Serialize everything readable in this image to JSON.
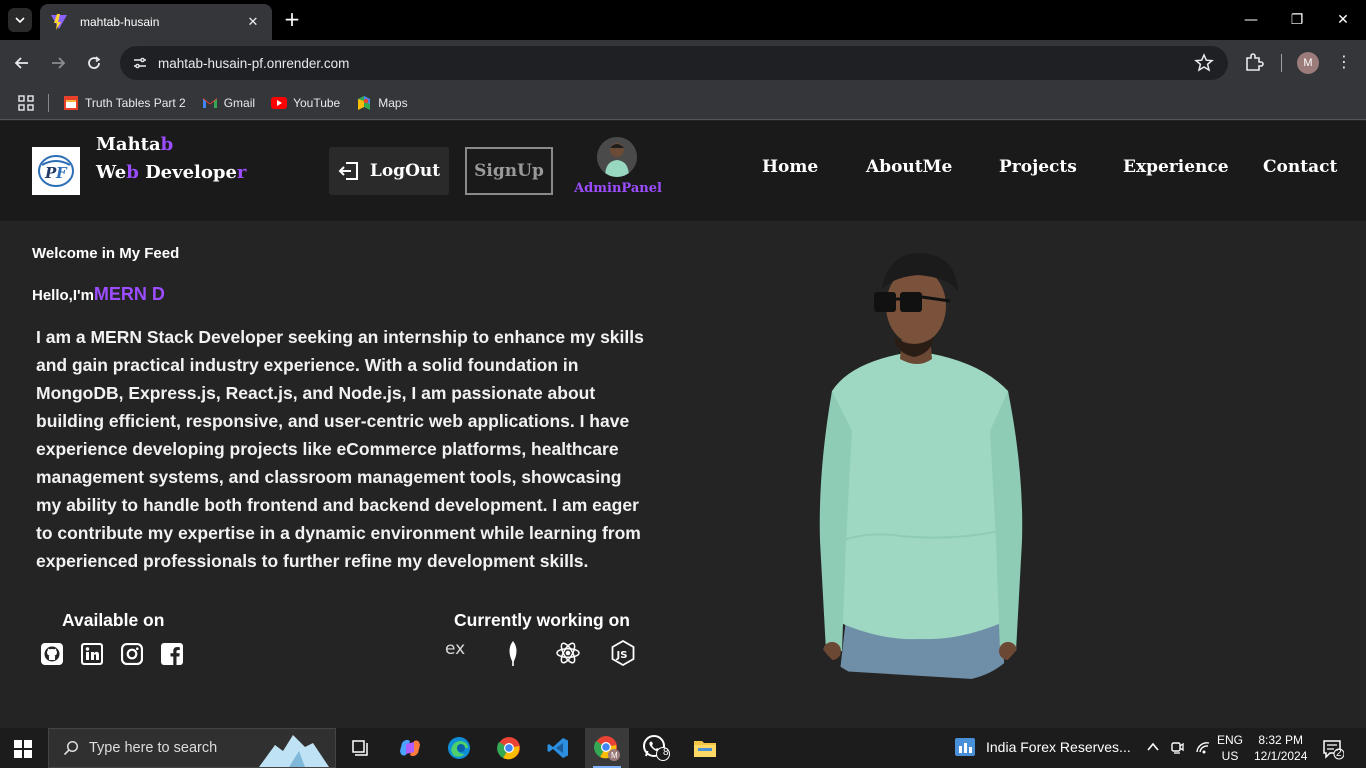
{
  "browser": {
    "tab_title": "mahtab-husain",
    "url": "mahtab-husain-pf.onrender.com",
    "bookmarks": [
      {
        "label": "Truth Tables Part 2",
        "icon": "truth-tables-favicon"
      },
      {
        "label": "Gmail",
        "icon": "gmail-icon"
      },
      {
        "label": "YouTube",
        "icon": "youtube-icon"
      },
      {
        "label": "Maps",
        "icon": "maps-icon"
      }
    ],
    "profile_initial": "M"
  },
  "site": {
    "brand_name_main": "Mahta",
    "brand_name_accent": "b",
    "brand_role_parts": [
      "We",
      "b",
      " Develope",
      "r"
    ],
    "logout_label": "LogOut",
    "signup_label": "SignUp",
    "admin_label": "AdminPanel",
    "nav": [
      "Home",
      "AboutMe",
      "Projects",
      "Experience",
      "Contact"
    ],
    "welcome": "Welcome in My Feed",
    "hello_prefix": "Hello,I'm",
    "hello_role": "MERN D",
    "bio": "I am a MERN Stack Developer seeking an internship to enhance my skills and gain practical industry experience. With a solid foundation in MongoDB, Express.js, React.js, and Node.js, I am passionate about building efficient, responsive, and user-centric web applications. I have experience developing projects like eCommerce platforms, healthcare management systems, and classroom management tools, showcasing my ability to handle both frontend and backend development. I am eager to contribute my expertise in a dynamic environment while learning from experienced professionals to further refine my development skills.",
    "available_title": "Available on",
    "social_icons": [
      "github-icon",
      "linkedin-icon",
      "instagram-icon",
      "facebook-icon"
    ],
    "working_title": "Currently working on",
    "tech_icons": [
      "express-icon",
      "mongodb-icon",
      "react-icon",
      "nodejs-icon"
    ],
    "accent_color": "#9b4dff"
  },
  "taskbar": {
    "search_placeholder": "Type here to search",
    "whatsapp_badge": "8",
    "news_text": "India Forex Reserves...",
    "lang_top": "ENG",
    "lang_bottom": "US",
    "time": "8:32 PM",
    "date": "12/1/2024",
    "notification_count": "2"
  }
}
